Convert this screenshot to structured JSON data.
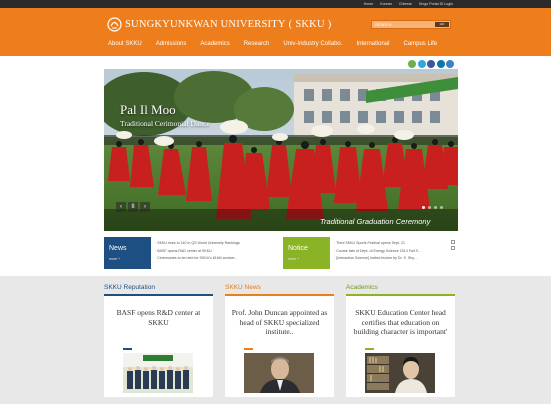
{
  "util_links": [
    "Home",
    "Korean",
    "Chinese",
    "Kingo Portal ID Login"
  ],
  "header": {
    "university_name": "SUNGKYUNKWAN UNIVERSITY",
    "abbr": "SKKU",
    "search_placeholder": "SEARCH",
    "search_button": "GO"
  },
  "nav": [
    "About SKKU",
    "Admissions",
    "Academics",
    "Research",
    "Univ-Industry Collabo.",
    "International",
    "Campus Life"
  ],
  "social_icons": [
    {
      "name": "blog-icon",
      "color": "#6ab04c"
    },
    {
      "name": "twitter-icon",
      "color": "#2da9e0"
    },
    {
      "name": "facebook-icon",
      "color": "#3b5998"
    },
    {
      "name": "linkedin-icon",
      "color": "#0e76a8"
    },
    {
      "name": "flickr-icon",
      "color": "#3a83c5"
    }
  ],
  "hero": {
    "title": "Pal Il Moo",
    "subtitle": "Traditional Cerimonial Dance",
    "caption": "Traditional Graduation Ceremony",
    "prev": "‹",
    "pause": "II",
    "next": "›"
  },
  "news": {
    "label": "News",
    "more": "more +",
    "color": "#1d4f82",
    "items": [
      "· SKKU rises to 140 in QS World University Rankings",
      "· BASF opens R&D center at SKKU",
      "· Ceremonies to be held for SKKU's 616th anniver..."
    ]
  },
  "notice": {
    "label": "Notice",
    "more": "more +",
    "color": "#8ab325",
    "items": [
      "· Third SKKU Sports Festival opens Sept. 21",
      "· Course lists of Dept. of Energy Science 2014 Fall S..",
      "· [Interaction Science] Invited lecture by Dr. S. Shy..."
    ]
  },
  "columns": [
    {
      "heading": "SKKU Reputation",
      "heading_color": "#1d4f82",
      "rule_color": "#1d4f82",
      "title": "BASF opens R&D center at SKKU",
      "accent": "#1d4f82"
    },
    {
      "heading": "SKKU News",
      "heading_color": "#e07a1a",
      "rule_color": "#ee7d1c",
      "title": "Prof. John Duncan appointed as head of SKKU specialized institute..",
      "accent": "#ee7d1c"
    },
    {
      "heading": "Academics",
      "heading_color": "#6e9a1a",
      "rule_color": "#8ab325",
      "title": "SKKU Education Center head certifies that education on building character is important'",
      "accent": "#8ab325"
    }
  ]
}
